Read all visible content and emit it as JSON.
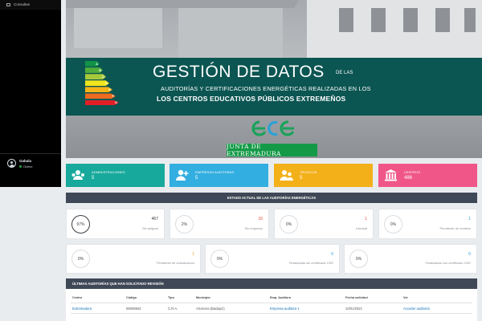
{
  "sidebar": {
    "items": [
      {
        "label": "Consultas",
        "icon": "folder-icon"
      }
    ],
    "user": {
      "name": "Gabala",
      "status": "Online"
    }
  },
  "banner": {
    "title": "GESTIÓN DE DATOS",
    "title_suffix": "DE LAS",
    "line2": "AUDITORÍAS Y CERTIFICACIONES ENERGÉTICAS REALIZADAS EN LOS",
    "line3": "LOS CENTROS EDUCATIVOS PÚBLICOS EXTREMEÑOS",
    "energy_labels": [
      "A",
      "B",
      "C",
      "D",
      "E",
      "F",
      "G"
    ],
    "energy_colors": [
      "#119448",
      "#4fae3b",
      "#a6c93a",
      "#f0e61d",
      "#f5b418",
      "#ec6b1f",
      "#e21f26"
    ],
    "brand": "JUNTA DE EXTREMADURA"
  },
  "stats": [
    {
      "label": "ADMINISTRACIONES",
      "value": "5",
      "color": "#17a99b",
      "icon": "users-gear-icon"
    },
    {
      "label": "EMPRESAS AUDITORAS",
      "value": "5",
      "color": "#33aee0",
      "icon": "add-user-icon"
    },
    {
      "label": "TÉCNICOS",
      "value": "5",
      "color": "#f3b019",
      "icon": "technicians-icon"
    },
    {
      "label": "CENTROS",
      "value": "486",
      "color": "#f05688",
      "icon": "institution-icon"
    }
  ],
  "status_section": {
    "title": "ESTADO ACTUAL DE LAS AUDITORÍAS ENERGÉTICAS",
    "row1": [
      {
        "percent": "97%",
        "count": "467",
        "label": "Sin asignar",
        "count_color": "#333333"
      },
      {
        "percent": "2%",
        "count": "16",
        "label": "Sin empezar",
        "count_color": "#e9483f"
      },
      {
        "percent": "0%",
        "count": "1",
        "label": "Iniciada",
        "count_color": "#e9483f"
      },
      {
        "percent": "0%",
        "count": "1",
        "label": "Pendiente de revisión",
        "count_color": "#2a9fd8"
      }
    ],
    "row2": [
      {
        "percent": "0%",
        "count": "1",
        "label": "Pendiente de subsanación",
        "count_color": "#f39c12"
      },
      {
        "percent": "0%",
        "count": "0",
        "label": "Finalizadas sin certificado CEE",
        "count_color": "#2a9fd8"
      },
      {
        "percent": "0%",
        "count": "0",
        "label": "Finalizadas con certificado CEE",
        "count_color": "#2a9fd8"
      }
    ]
  },
  "recent": {
    "title": "ÚLTIMAS AUDITORÍAS QUE HAN SOLICITADO REVISIÓN",
    "columns": [
      "Centro",
      "Código",
      "Tipo",
      "Municipio",
      "Emp. Auditora",
      "Fecha solicitud",
      "Ver"
    ],
    "rows": [
      [
        "Extremadura",
        "06006942",
        "C.R.A.",
        "Alconera (Badajoz)",
        "Empresa auditora 1",
        "10/01/2021",
        "Acceder auditoría"
      ]
    ]
  }
}
